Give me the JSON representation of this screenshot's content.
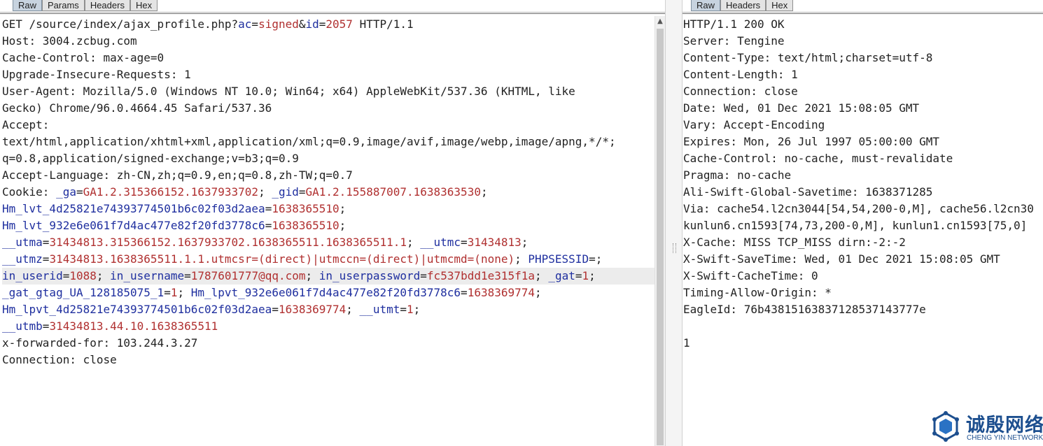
{
  "request": {
    "tabs": [
      "Raw",
      "Params",
      "Headers",
      "Hex"
    ],
    "active_tab": "Raw",
    "lines": [
      [
        {
          "t": "GET /source/index/ajax_profile.php?"
        },
        {
          "t": "ac",
          "c": "k"
        },
        {
          "t": "="
        },
        {
          "t": "signed",
          "c": "v"
        },
        {
          "t": "&"
        },
        {
          "t": "id",
          "c": "k"
        },
        {
          "t": "="
        },
        {
          "t": "2057",
          "c": "v"
        },
        {
          "t": " HTTP/1.1"
        }
      ],
      [
        {
          "t": "Host: 3004.zcbug.com"
        }
      ],
      [
        {
          "t": "Cache-Control: max-age=0"
        }
      ],
      [
        {
          "t": "Upgrade-Insecure-Requests: 1"
        }
      ],
      [
        {
          "t": "User-Agent: Mozilla/5.0 (Windows NT 10.0; Win64; x64) AppleWebKit/537.36 (KHTML, like"
        }
      ],
      [
        {
          "t": "Gecko) Chrome/96.0.4664.45 Safari/537.36"
        }
      ],
      [
        {
          "t": "Accept:"
        }
      ],
      [
        {
          "t": "text/html,application/xhtml+xml,application/xml;q=0.9,image/avif,image/webp,image/apng,*/*;"
        }
      ],
      [
        {
          "t": "q=0.8,application/signed-exchange;v=b3;q=0.9"
        }
      ],
      [
        {
          "t": "Accept-Language: zh-CN,zh;q=0.9,en;q=0.8,zh-TW;q=0.7"
        }
      ],
      [
        {
          "t": "Cookie: "
        },
        {
          "t": "_ga",
          "c": "k"
        },
        {
          "t": "="
        },
        {
          "t": "GA1.2.315366152.1637933702",
          "c": "v"
        },
        {
          "t": "; "
        },
        {
          "t": "_gid",
          "c": "k"
        },
        {
          "t": "="
        },
        {
          "t": "GA1.2.155887007.1638363530",
          "c": "v"
        },
        {
          "t": ";"
        }
      ],
      [
        {
          "t": "Hm_lvt_4d25821e74393774501b6c02f03d2aea",
          "c": "k"
        },
        {
          "t": "="
        },
        {
          "t": "1638365510",
          "c": "v"
        },
        {
          "t": ";"
        }
      ],
      [
        {
          "t": "Hm_lvt_932e6e061f7d4ac477e82f20fd3778c6",
          "c": "k"
        },
        {
          "t": "="
        },
        {
          "t": "1638365510",
          "c": "v"
        },
        {
          "t": ";"
        }
      ],
      [
        {
          "t": "__utma",
          "c": "k"
        },
        {
          "t": "="
        },
        {
          "t": "31434813.315366152.1637933702.1638365511.1638365511.1",
          "c": "v"
        },
        {
          "t": "; "
        },
        {
          "t": "__utmc",
          "c": "k"
        },
        {
          "t": "="
        },
        {
          "t": "31434813",
          "c": "v"
        },
        {
          "t": ";"
        }
      ],
      [
        {
          "t": "__utmz",
          "c": "k"
        },
        {
          "t": "="
        },
        {
          "t": "31434813.1638365511.1.1.utmcsr=(direct)|utmccn=(direct)|utmcmd=(none)",
          "c": "v"
        },
        {
          "t": "; "
        },
        {
          "t": "PHPSESSID",
          "c": "k"
        },
        {
          "t": "=;"
        }
      ],
      [
        {
          "t": "in_userid",
          "c": "k"
        },
        {
          "t": "="
        },
        {
          "t": "1088",
          "c": "v"
        },
        {
          "t": "; "
        },
        {
          "t": "in_username",
          "c": "k"
        },
        {
          "t": "="
        },
        {
          "t": "1787601777@qq.com",
          "c": "v"
        },
        {
          "t": "; "
        },
        {
          "t": "in_userpassword",
          "c": "k"
        },
        {
          "t": "="
        },
        {
          "t": "fc537bdd1e315f1a",
          "c": "v"
        },
        {
          "t": "; "
        },
        {
          "t": "_gat",
          "c": "k"
        },
        {
          "t": "="
        },
        {
          "t": "1",
          "c": "v"
        },
        {
          "t": ";"
        }
      ],
      [
        {
          "t": "_gat_gtag_UA_128185075_1",
          "c": "k"
        },
        {
          "t": "="
        },
        {
          "t": "1",
          "c": "v"
        },
        {
          "t": "; "
        },
        {
          "t": "Hm_lpvt_932e6e061f7d4ac477e82f20fd3778c6",
          "c": "k"
        },
        {
          "t": "="
        },
        {
          "t": "1638369774",
          "c": "v"
        },
        {
          "t": ";"
        }
      ],
      [
        {
          "t": "Hm_lpvt_4d25821e74393774501b6c02f03d2aea",
          "c": "k"
        },
        {
          "t": "="
        },
        {
          "t": "1638369774",
          "c": "v"
        },
        {
          "t": "; "
        },
        {
          "t": "__utmt",
          "c": "k"
        },
        {
          "t": "="
        },
        {
          "t": "1",
          "c": "v"
        },
        {
          "t": ";"
        }
      ],
      [
        {
          "t": "__utmb",
          "c": "k"
        },
        {
          "t": "="
        },
        {
          "t": "31434813.44.10.1638365511",
          "c": "v"
        }
      ],
      [
        {
          "t": "x-forwarded-for: 103.244.3.27"
        }
      ],
      [
        {
          "t": "Connection: close"
        }
      ]
    ],
    "highlighted_line": 15
  },
  "response": {
    "tabs": [
      "Raw",
      "Headers",
      "Hex"
    ],
    "active_tab": "Raw",
    "lines": [
      "HTTP/1.1 200 OK",
      "Server: Tengine",
      "Content-Type: text/html;charset=utf-8",
      "Content-Length: 1",
      "Connection: close",
      "Date: Wed, 01 Dec 2021 15:08:05 GMT",
      "Vary: Accept-Encoding",
      "Expires: Mon, 26 Jul 1997 05:00:00 GMT",
      "Cache-Control: no-cache, must-revalidate",
      "Pragma: no-cache",
      "Ali-Swift-Global-Savetime: 1638371285",
      "Via: cache54.l2cn3044[54,54,200-0,M], cache56.l2cn30",
      "kunlun6.cn1593[74,73,200-0,M], kunlun1.cn1593[75,0]",
      "X-Cache: MISS TCP_MISS dirn:-2:-2",
      "X-Swift-SaveTime: Wed, 01 Dec 2021 15:08:05 GMT",
      "X-Swift-CacheTime: 0",
      "Timing-Allow-Origin: *",
      "EagleId: 76b43815163837128537143777e",
      "",
      "1"
    ]
  },
  "watermark": {
    "cn": "诚殷网络",
    "en": "CHENG YIN NETWORK"
  },
  "colors": {
    "key": "#1f2f9f",
    "value": "#b03030",
    "active_tab": "#c7d3df",
    "logo": "#1d4f8f"
  }
}
